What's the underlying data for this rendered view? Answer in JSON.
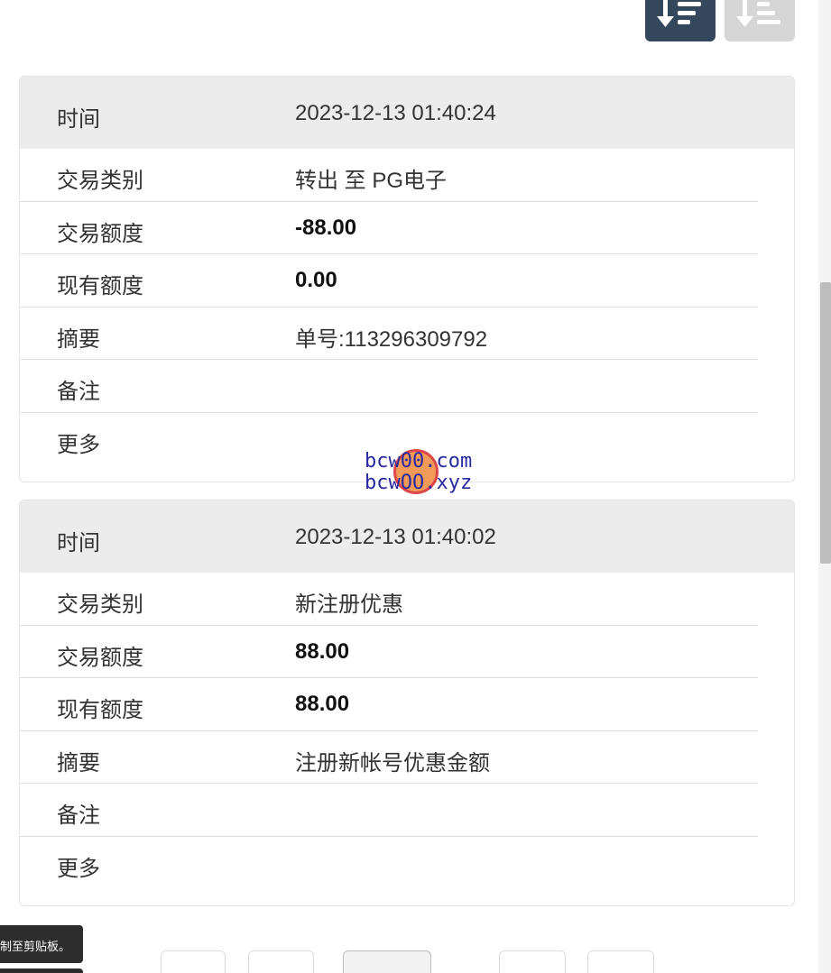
{
  "toolbar": {
    "sort_desc_icon": "sort-descending-icon",
    "sort_asc_icon": "sort-ascending-icon",
    "active_color": "#34475c",
    "inactive_color": "#d6d6d6"
  },
  "records": [
    {
      "time_label": "时间",
      "time_value": "2023-12-13 01:40:24",
      "type_label": "交易类别",
      "type_value": "转出 至 PG电子",
      "amount_label": "交易额度",
      "amount_value": "-88.00",
      "balance_label": "现有额度",
      "balance_value": "0.00",
      "summary_label": "摘要",
      "summary_value": "单号:113296309792",
      "note_label": "备注",
      "note_value": "",
      "more_label": "更多"
    },
    {
      "time_label": "时间",
      "time_value": "2023-12-13 01:40:02",
      "type_label": "交易类别",
      "type_value": "新注册优惠",
      "amount_label": "交易额度",
      "amount_value": "88.00",
      "balance_label": "现有额度",
      "balance_value": "88.00",
      "summary_label": "摘要",
      "summary_value": "注册新帐号优惠金额",
      "note_label": "备注",
      "note_value": "",
      "more_label": "更多"
    }
  ],
  "watermark": {
    "line1": "bcw00.com",
    "line2": "bcwOO.xyz"
  },
  "toast": {
    "text": "制至剪贴板。"
  }
}
